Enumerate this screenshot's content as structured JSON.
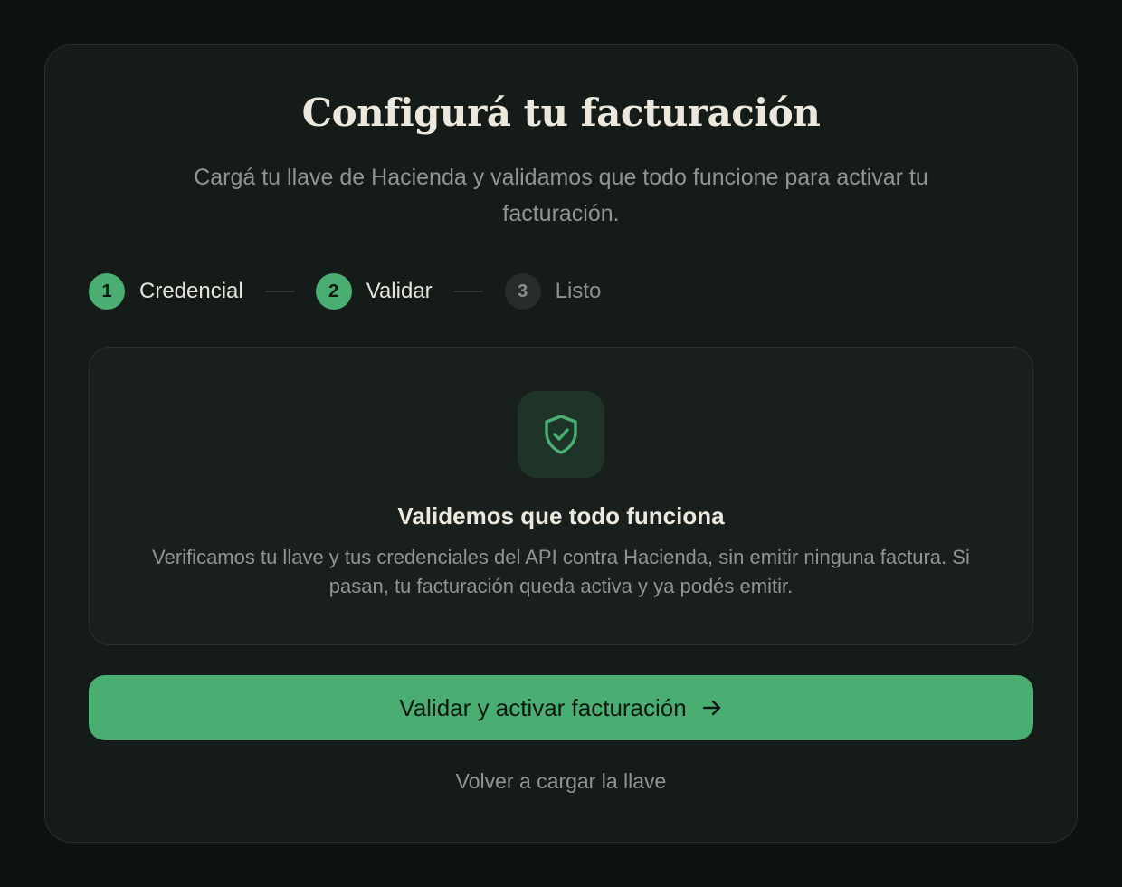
{
  "header": {
    "title": "Configurá tu facturación",
    "subtitle": "Cargá tu llave de Hacienda y validamos que todo funcione para activar tu facturación."
  },
  "steps": [
    {
      "number": "1",
      "label": "Credencial",
      "state": "active"
    },
    {
      "number": "2",
      "label": "Validar",
      "state": "active"
    },
    {
      "number": "3",
      "label": "Listo",
      "state": "pending"
    }
  ],
  "panel": {
    "icon": "shield-check-icon",
    "title": "Validemos que todo funciona",
    "text": "Verificamos tu llave y tus credenciales del API contra Hacienda, sin emitir ninguna factura. Si pasan, tu facturación queda activa y ya podés emitir."
  },
  "actions": {
    "primary_label": "Validar y activar facturación",
    "primary_icon": "arrow-right-icon",
    "secondary_label": "Volver a cargar la llave"
  },
  "colors": {
    "accent": "#4aae72",
    "background": "#0d1210",
    "card": "#151b18"
  }
}
